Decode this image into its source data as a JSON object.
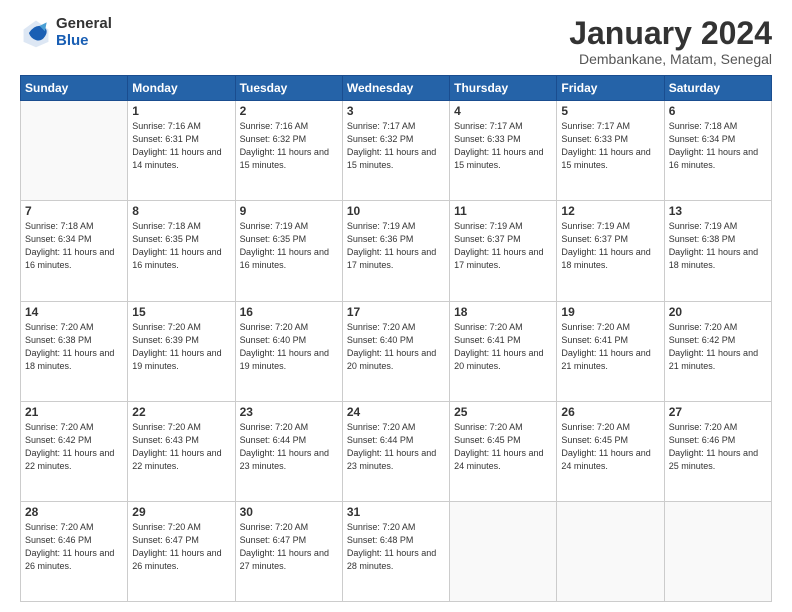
{
  "logo": {
    "general": "General",
    "blue": "Blue"
  },
  "title": "January 2024",
  "location": "Dembankane, Matam, Senegal",
  "days_header": [
    "Sunday",
    "Monday",
    "Tuesday",
    "Wednesday",
    "Thursday",
    "Friday",
    "Saturday"
  ],
  "weeks": [
    [
      {
        "day": "",
        "sunrise": "",
        "sunset": "",
        "daylight": ""
      },
      {
        "day": "1",
        "sunrise": "Sunrise: 7:16 AM",
        "sunset": "Sunset: 6:31 PM",
        "daylight": "Daylight: 11 hours and 14 minutes."
      },
      {
        "day": "2",
        "sunrise": "Sunrise: 7:16 AM",
        "sunset": "Sunset: 6:32 PM",
        "daylight": "Daylight: 11 hours and 15 minutes."
      },
      {
        "day": "3",
        "sunrise": "Sunrise: 7:17 AM",
        "sunset": "Sunset: 6:32 PM",
        "daylight": "Daylight: 11 hours and 15 minutes."
      },
      {
        "day": "4",
        "sunrise": "Sunrise: 7:17 AM",
        "sunset": "Sunset: 6:33 PM",
        "daylight": "Daylight: 11 hours and 15 minutes."
      },
      {
        "day": "5",
        "sunrise": "Sunrise: 7:17 AM",
        "sunset": "Sunset: 6:33 PM",
        "daylight": "Daylight: 11 hours and 15 minutes."
      },
      {
        "day": "6",
        "sunrise": "Sunrise: 7:18 AM",
        "sunset": "Sunset: 6:34 PM",
        "daylight": "Daylight: 11 hours and 16 minutes."
      }
    ],
    [
      {
        "day": "7",
        "sunrise": "Sunrise: 7:18 AM",
        "sunset": "Sunset: 6:34 PM",
        "daylight": "Daylight: 11 hours and 16 minutes."
      },
      {
        "day": "8",
        "sunrise": "Sunrise: 7:18 AM",
        "sunset": "Sunset: 6:35 PM",
        "daylight": "Daylight: 11 hours and 16 minutes."
      },
      {
        "day": "9",
        "sunrise": "Sunrise: 7:19 AM",
        "sunset": "Sunset: 6:35 PM",
        "daylight": "Daylight: 11 hours and 16 minutes."
      },
      {
        "day": "10",
        "sunrise": "Sunrise: 7:19 AM",
        "sunset": "Sunset: 6:36 PM",
        "daylight": "Daylight: 11 hours and 17 minutes."
      },
      {
        "day": "11",
        "sunrise": "Sunrise: 7:19 AM",
        "sunset": "Sunset: 6:37 PM",
        "daylight": "Daylight: 11 hours and 17 minutes."
      },
      {
        "day": "12",
        "sunrise": "Sunrise: 7:19 AM",
        "sunset": "Sunset: 6:37 PM",
        "daylight": "Daylight: 11 hours and 18 minutes."
      },
      {
        "day": "13",
        "sunrise": "Sunrise: 7:19 AM",
        "sunset": "Sunset: 6:38 PM",
        "daylight": "Daylight: 11 hours and 18 minutes."
      }
    ],
    [
      {
        "day": "14",
        "sunrise": "Sunrise: 7:20 AM",
        "sunset": "Sunset: 6:38 PM",
        "daylight": "Daylight: 11 hours and 18 minutes."
      },
      {
        "day": "15",
        "sunrise": "Sunrise: 7:20 AM",
        "sunset": "Sunset: 6:39 PM",
        "daylight": "Daylight: 11 hours and 19 minutes."
      },
      {
        "day": "16",
        "sunrise": "Sunrise: 7:20 AM",
        "sunset": "Sunset: 6:40 PM",
        "daylight": "Daylight: 11 hours and 19 minutes."
      },
      {
        "day": "17",
        "sunrise": "Sunrise: 7:20 AM",
        "sunset": "Sunset: 6:40 PM",
        "daylight": "Daylight: 11 hours and 20 minutes."
      },
      {
        "day": "18",
        "sunrise": "Sunrise: 7:20 AM",
        "sunset": "Sunset: 6:41 PM",
        "daylight": "Daylight: 11 hours and 20 minutes."
      },
      {
        "day": "19",
        "sunrise": "Sunrise: 7:20 AM",
        "sunset": "Sunset: 6:41 PM",
        "daylight": "Daylight: 11 hours and 21 minutes."
      },
      {
        "day": "20",
        "sunrise": "Sunrise: 7:20 AM",
        "sunset": "Sunset: 6:42 PM",
        "daylight": "Daylight: 11 hours and 21 minutes."
      }
    ],
    [
      {
        "day": "21",
        "sunrise": "Sunrise: 7:20 AM",
        "sunset": "Sunset: 6:42 PM",
        "daylight": "Daylight: 11 hours and 22 minutes."
      },
      {
        "day": "22",
        "sunrise": "Sunrise: 7:20 AM",
        "sunset": "Sunset: 6:43 PM",
        "daylight": "Daylight: 11 hours and 22 minutes."
      },
      {
        "day": "23",
        "sunrise": "Sunrise: 7:20 AM",
        "sunset": "Sunset: 6:44 PM",
        "daylight": "Daylight: 11 hours and 23 minutes."
      },
      {
        "day": "24",
        "sunrise": "Sunrise: 7:20 AM",
        "sunset": "Sunset: 6:44 PM",
        "daylight": "Daylight: 11 hours and 23 minutes."
      },
      {
        "day": "25",
        "sunrise": "Sunrise: 7:20 AM",
        "sunset": "Sunset: 6:45 PM",
        "daylight": "Daylight: 11 hours and 24 minutes."
      },
      {
        "day": "26",
        "sunrise": "Sunrise: 7:20 AM",
        "sunset": "Sunset: 6:45 PM",
        "daylight": "Daylight: 11 hours and 24 minutes."
      },
      {
        "day": "27",
        "sunrise": "Sunrise: 7:20 AM",
        "sunset": "Sunset: 6:46 PM",
        "daylight": "Daylight: 11 hours and 25 minutes."
      }
    ],
    [
      {
        "day": "28",
        "sunrise": "Sunrise: 7:20 AM",
        "sunset": "Sunset: 6:46 PM",
        "daylight": "Daylight: 11 hours and 26 minutes."
      },
      {
        "day": "29",
        "sunrise": "Sunrise: 7:20 AM",
        "sunset": "Sunset: 6:47 PM",
        "daylight": "Daylight: 11 hours and 26 minutes."
      },
      {
        "day": "30",
        "sunrise": "Sunrise: 7:20 AM",
        "sunset": "Sunset: 6:47 PM",
        "daylight": "Daylight: 11 hours and 27 minutes."
      },
      {
        "day": "31",
        "sunrise": "Sunrise: 7:20 AM",
        "sunset": "Sunset: 6:48 PM",
        "daylight": "Daylight: 11 hours and 28 minutes."
      },
      {
        "day": "",
        "sunrise": "",
        "sunset": "",
        "daylight": ""
      },
      {
        "day": "",
        "sunrise": "",
        "sunset": "",
        "daylight": ""
      },
      {
        "day": "",
        "sunrise": "",
        "sunset": "",
        "daylight": ""
      }
    ]
  ]
}
